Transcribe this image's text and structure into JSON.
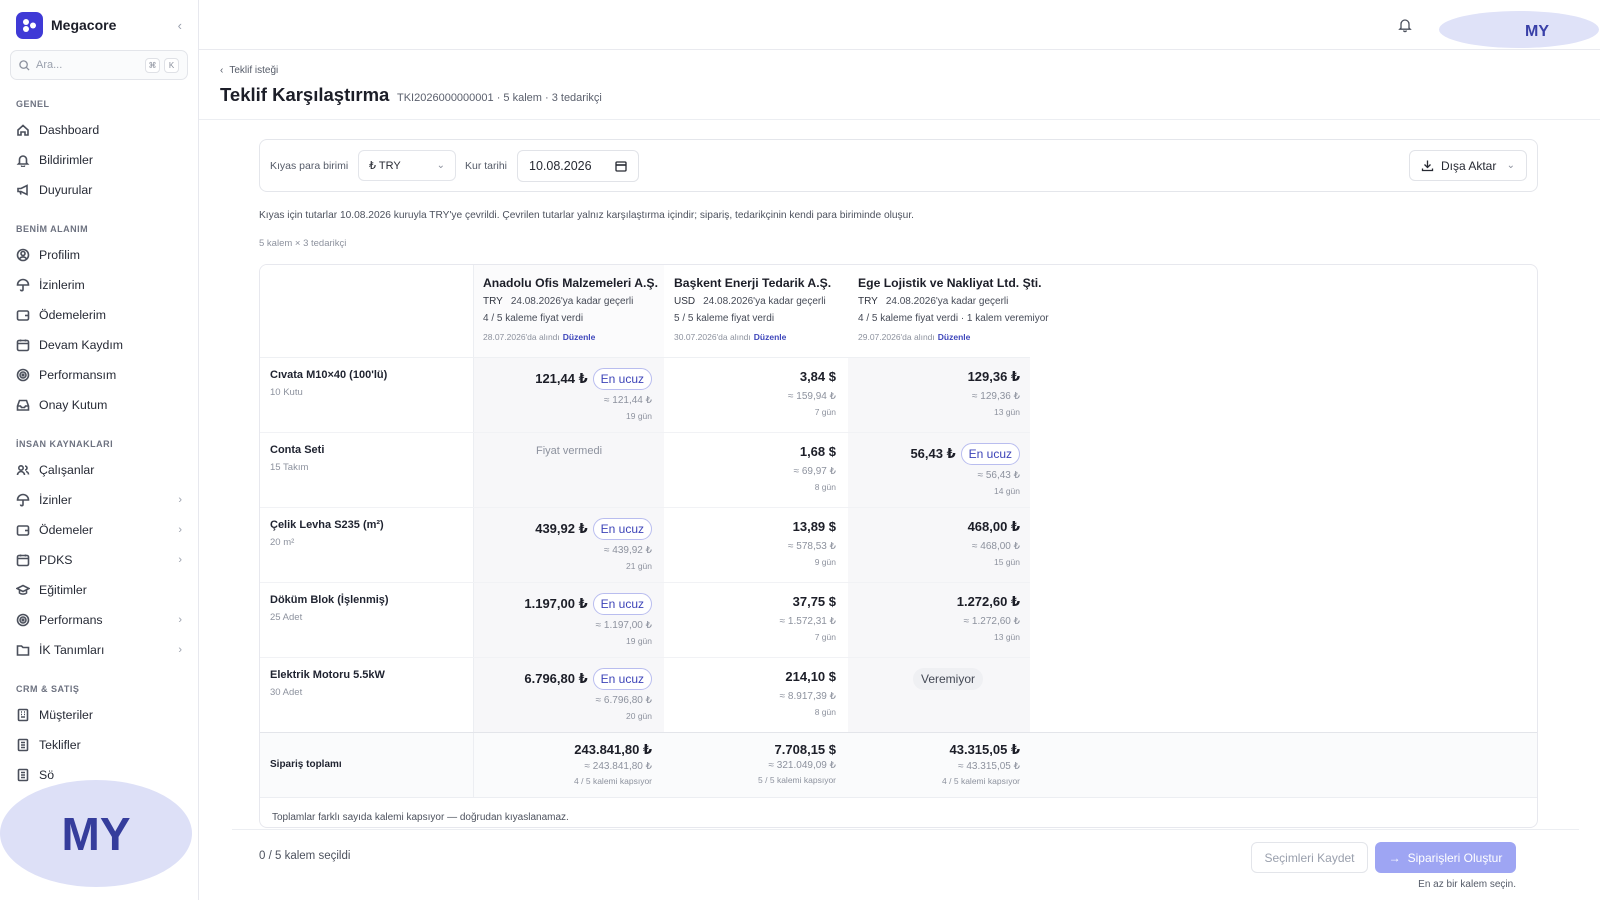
{
  "app": {
    "name": "Megacore",
    "collapse_icon": "chevron-left-icon"
  },
  "search": {
    "placeholder": "Ara...",
    "kbd1": "⌘",
    "kbd2": "K"
  },
  "sidebar": {
    "sections": [
      {
        "title": "GENEL",
        "items": [
          {
            "label": "Dashboard",
            "icon": "home-icon"
          },
          {
            "label": "Bildirimler",
            "icon": "bell-icon"
          },
          {
            "label": "Duyurular",
            "icon": "megaphone-icon"
          }
        ]
      },
      {
        "title": "BENİM ALANIM",
        "items": [
          {
            "label": "Profilim",
            "icon": "user-circle-icon"
          },
          {
            "label": "İzinlerim",
            "icon": "umbrella-icon"
          },
          {
            "label": "Ödemelerim",
            "icon": "wallet-icon"
          },
          {
            "label": "Devam Kaydım",
            "icon": "calendar-icon"
          },
          {
            "label": "Performansım",
            "icon": "target-icon"
          },
          {
            "label": "Onay Kutum",
            "icon": "inbox-icon"
          }
        ]
      },
      {
        "title": "İNSAN KAYNAKLARI",
        "items": [
          {
            "label": "Çalışanlar",
            "icon": "users-icon"
          },
          {
            "label": "İzinler",
            "icon": "umbrella-icon",
            "chevron": "›"
          },
          {
            "label": "Ödemeler",
            "icon": "wallet-icon",
            "chevron": "›"
          },
          {
            "label": "PDKS",
            "icon": "calendar-icon",
            "chevron": "›"
          },
          {
            "label": "Eğitimler",
            "icon": "graduation-cap-icon"
          },
          {
            "label": "Performans",
            "icon": "target-icon",
            "chevron": "›"
          },
          {
            "label": "İK Tanımları",
            "icon": "folder-icon",
            "chevron": "›"
          }
        ]
      },
      {
        "title": "CRM & SATIŞ",
        "items": [
          {
            "label": "Müşteriler",
            "icon": "building-icon"
          },
          {
            "label": "Teklifler",
            "icon": "document-icon"
          },
          {
            "label": "Sö",
            "icon": "document-icon"
          }
        ]
      }
    ]
  },
  "topbar": {
    "avatar_initials": "MY",
    "watermark_initials": "MY"
  },
  "page": {
    "breadcrumb": "Teklif isteği",
    "title": "Teklif Karşılaştırma",
    "subtitle": "TKI2026000000001 · 5 kalem · 3 tedarikçi"
  },
  "filters": {
    "currency_label": "Kıyas para birimi",
    "currency_value": "₺ TRY",
    "date_label": "Kur tarihi",
    "date_value": "10.08.2026",
    "export_label": "Dışa Aktar"
  },
  "info_note": "Kıyas için tutarlar 10.08.2026 kuruyla TRY'ye çevrildi. Çevrilen tutarlar yalnız karşılaştırma içindir; sipariş, tedarikçinin kendi para biriminde oluşur.",
  "matrix_count": "5 kalem × 3 tedarikçi",
  "suppliers": [
    {
      "name": "Anadolu Ofis Malzemeleri A.Ş.",
      "currency": "TRY",
      "validity": "24.08.2026'ya kadar geçerli",
      "coverage": "4 / 5 kaleme fiyat verdi",
      "received": "28.07.2026'da alındı",
      "edit": "Düzenle"
    },
    {
      "name": "Başkent Enerji Tedarik A.Ş.",
      "currency": "USD",
      "validity": "24.08.2026'ya kadar geçerli",
      "coverage": "5 / 5 kaleme fiyat verdi",
      "received": "30.07.2026'da alındı",
      "edit": "Düzenle"
    },
    {
      "name": "Ege Lojistik ve Nakliyat Ltd. Şti.",
      "currency": "TRY",
      "validity": "24.08.2026'ya kadar geçerli",
      "coverage": "4 / 5 kaleme fiyat verdi · 1 kalem veremiyor",
      "received": "29.07.2026'da alındı",
      "edit": "Düzenle"
    }
  ],
  "items": [
    {
      "name": "Cıvata M10×40 (100'lü)",
      "qty": "10 Kutu",
      "offers": [
        {
          "price": "121,44 ₺",
          "approx": "≈ 121,44 ₺",
          "days": "19 gün",
          "badge": "En ucuz"
        },
        {
          "price": "3,84 $",
          "approx": "≈ 159,94 ₺",
          "days": "7 gün"
        },
        {
          "price": "129,36 ₺",
          "approx": "≈ 129,36 ₺",
          "days": "13 gün"
        }
      ]
    },
    {
      "name": "Conta Seti",
      "qty": "15 Takım",
      "offers": [
        {
          "na": "Fiyat vermedi"
        },
        {
          "price": "1,68 $",
          "approx": "≈ 69,97 ₺",
          "days": "8 gün"
        },
        {
          "price": "56,43 ₺",
          "approx": "≈ 56,43 ₺",
          "days": "14 gün",
          "badge": "En ucuz"
        }
      ]
    },
    {
      "name": "Çelik Levha S235 (m²)",
      "qty": "20 m²",
      "offers": [
        {
          "price": "439,92 ₺",
          "approx": "≈ 439,92 ₺",
          "days": "21 gün",
          "badge": "En ucuz"
        },
        {
          "price": "13,89 $",
          "approx": "≈ 578,53 ₺",
          "days": "9 gün"
        },
        {
          "price": "468,00 ₺",
          "approx": "≈ 468,00 ₺",
          "days": "15 gün"
        }
      ]
    },
    {
      "name": "Döküm Blok (İşlenmiş)",
      "qty": "25 Adet",
      "offers": [
        {
          "price": "1.197,00 ₺",
          "approx": "≈ 1.197,00 ₺",
          "days": "19 gün",
          "badge": "En ucuz"
        },
        {
          "price": "37,75 $",
          "approx": "≈ 1.572,31 ₺",
          "days": "7 gün"
        },
        {
          "price": "1.272,60 ₺",
          "approx": "≈ 1.272,60 ₺",
          "days": "13 gün"
        }
      ]
    },
    {
      "name": "Elektrik Motoru 5.5kW",
      "qty": "30 Adet",
      "offers": [
        {
          "price": "6.796,80 ₺",
          "approx": "≈ 6.796,80 ₺",
          "days": "20 gün",
          "badge": "En ucuz"
        },
        {
          "price": "214,10 $",
          "approx": "≈ 8.917,39 ₺",
          "days": "8 gün"
        },
        {
          "unavailable": "Veremiyor"
        }
      ]
    }
  ],
  "totals": {
    "label": "Sipariş toplamı",
    "values": [
      {
        "price": "243.841,80 ₺",
        "approx": "≈ 243.841,80 ₺",
        "coverage": "4 / 5 kalemi kapsıyor"
      },
      {
        "price": "7.708,15 $",
        "approx": "≈ 321.049,09 ₺",
        "coverage": "5 / 5 kalemi kapsıyor"
      },
      {
        "price": "43.315,05 ₺",
        "approx": "≈ 43.315,05 ₺",
        "coverage": "4 / 5 kalemi kapsıyor"
      }
    ]
  },
  "totals_note": "Toplamlar farklı sayıda kalemi kapsıyor — doğrudan kıyaslanamaz.",
  "bottom": {
    "selection": "0 / 5 kalem seçildi",
    "save_label": "Seçimleri Kaydet",
    "create_label": "Siparişleri Oluştur",
    "hint": "En az bir kalem seçin."
  }
}
